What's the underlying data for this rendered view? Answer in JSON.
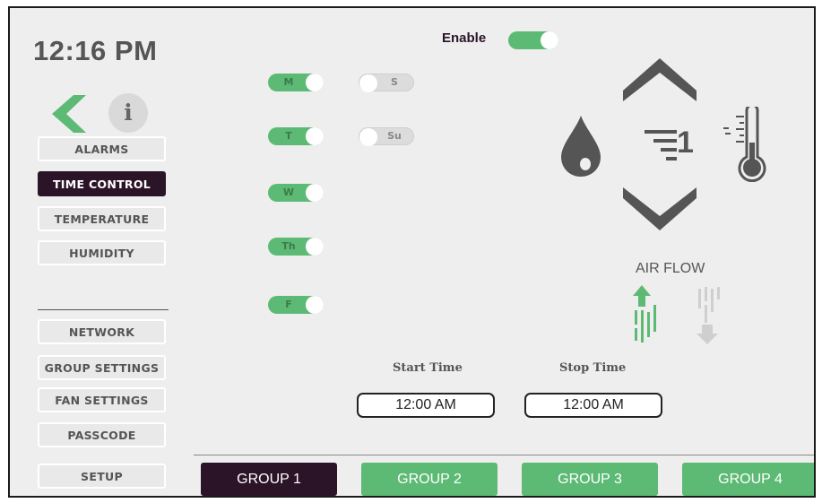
{
  "header": {
    "time": "12:16 PM",
    "info_label": "i"
  },
  "sidebar": {
    "items": [
      {
        "label": "ALARMS",
        "active": false
      },
      {
        "label": "TIME CONTROL",
        "active": true
      },
      {
        "label": "TEMPERATURE",
        "active": false
      },
      {
        "label": "HUMIDITY",
        "active": false
      }
    ],
    "settings": [
      {
        "label": "NETWORK"
      },
      {
        "label": "GROUP SETTINGS"
      },
      {
        "label": "FAN SETTINGS"
      },
      {
        "label": "PASSCODE"
      }
    ],
    "setup_label": "SETUP"
  },
  "enable": {
    "label": "Enable",
    "on": true
  },
  "days": [
    {
      "label": "M",
      "on": true
    },
    {
      "label": "T",
      "on": true
    },
    {
      "label": "W",
      "on": true
    },
    {
      "label": "Th",
      "on": true
    },
    {
      "label": "F",
      "on": true
    },
    {
      "label": "S",
      "on": false
    },
    {
      "label": "Su",
      "on": false
    }
  ],
  "schedule": {
    "start_label": "Start Time",
    "start_value": "12:00 AM",
    "stop_label": "Stop Time",
    "stop_value": "12:00 AM"
  },
  "fan": {
    "speed": "1",
    "airflow_label": "AIR FLOW"
  },
  "groups": [
    {
      "label": "GROUP 1",
      "active": true
    },
    {
      "label": "GROUP 2",
      "active": false
    },
    {
      "label": "GROUP 3",
      "active": false
    },
    {
      "label": "GROUP 4",
      "active": false
    }
  ],
  "icons": {
    "back": "chevron-left-icon",
    "info": "info-icon",
    "up": "chevron-up-icon",
    "down": "chevron-down-icon",
    "droplet": "droplet-icon",
    "thermometer": "thermometer-icon",
    "speed": "fan-speed-icon",
    "airflow_up": "airflow-up-icon",
    "airflow_down": "airflow-down-icon"
  },
  "colors": {
    "accent_green": "#5dba75",
    "active_dark": "#2c1428",
    "icon_gray": "#555555",
    "background": "#eeeeee"
  }
}
